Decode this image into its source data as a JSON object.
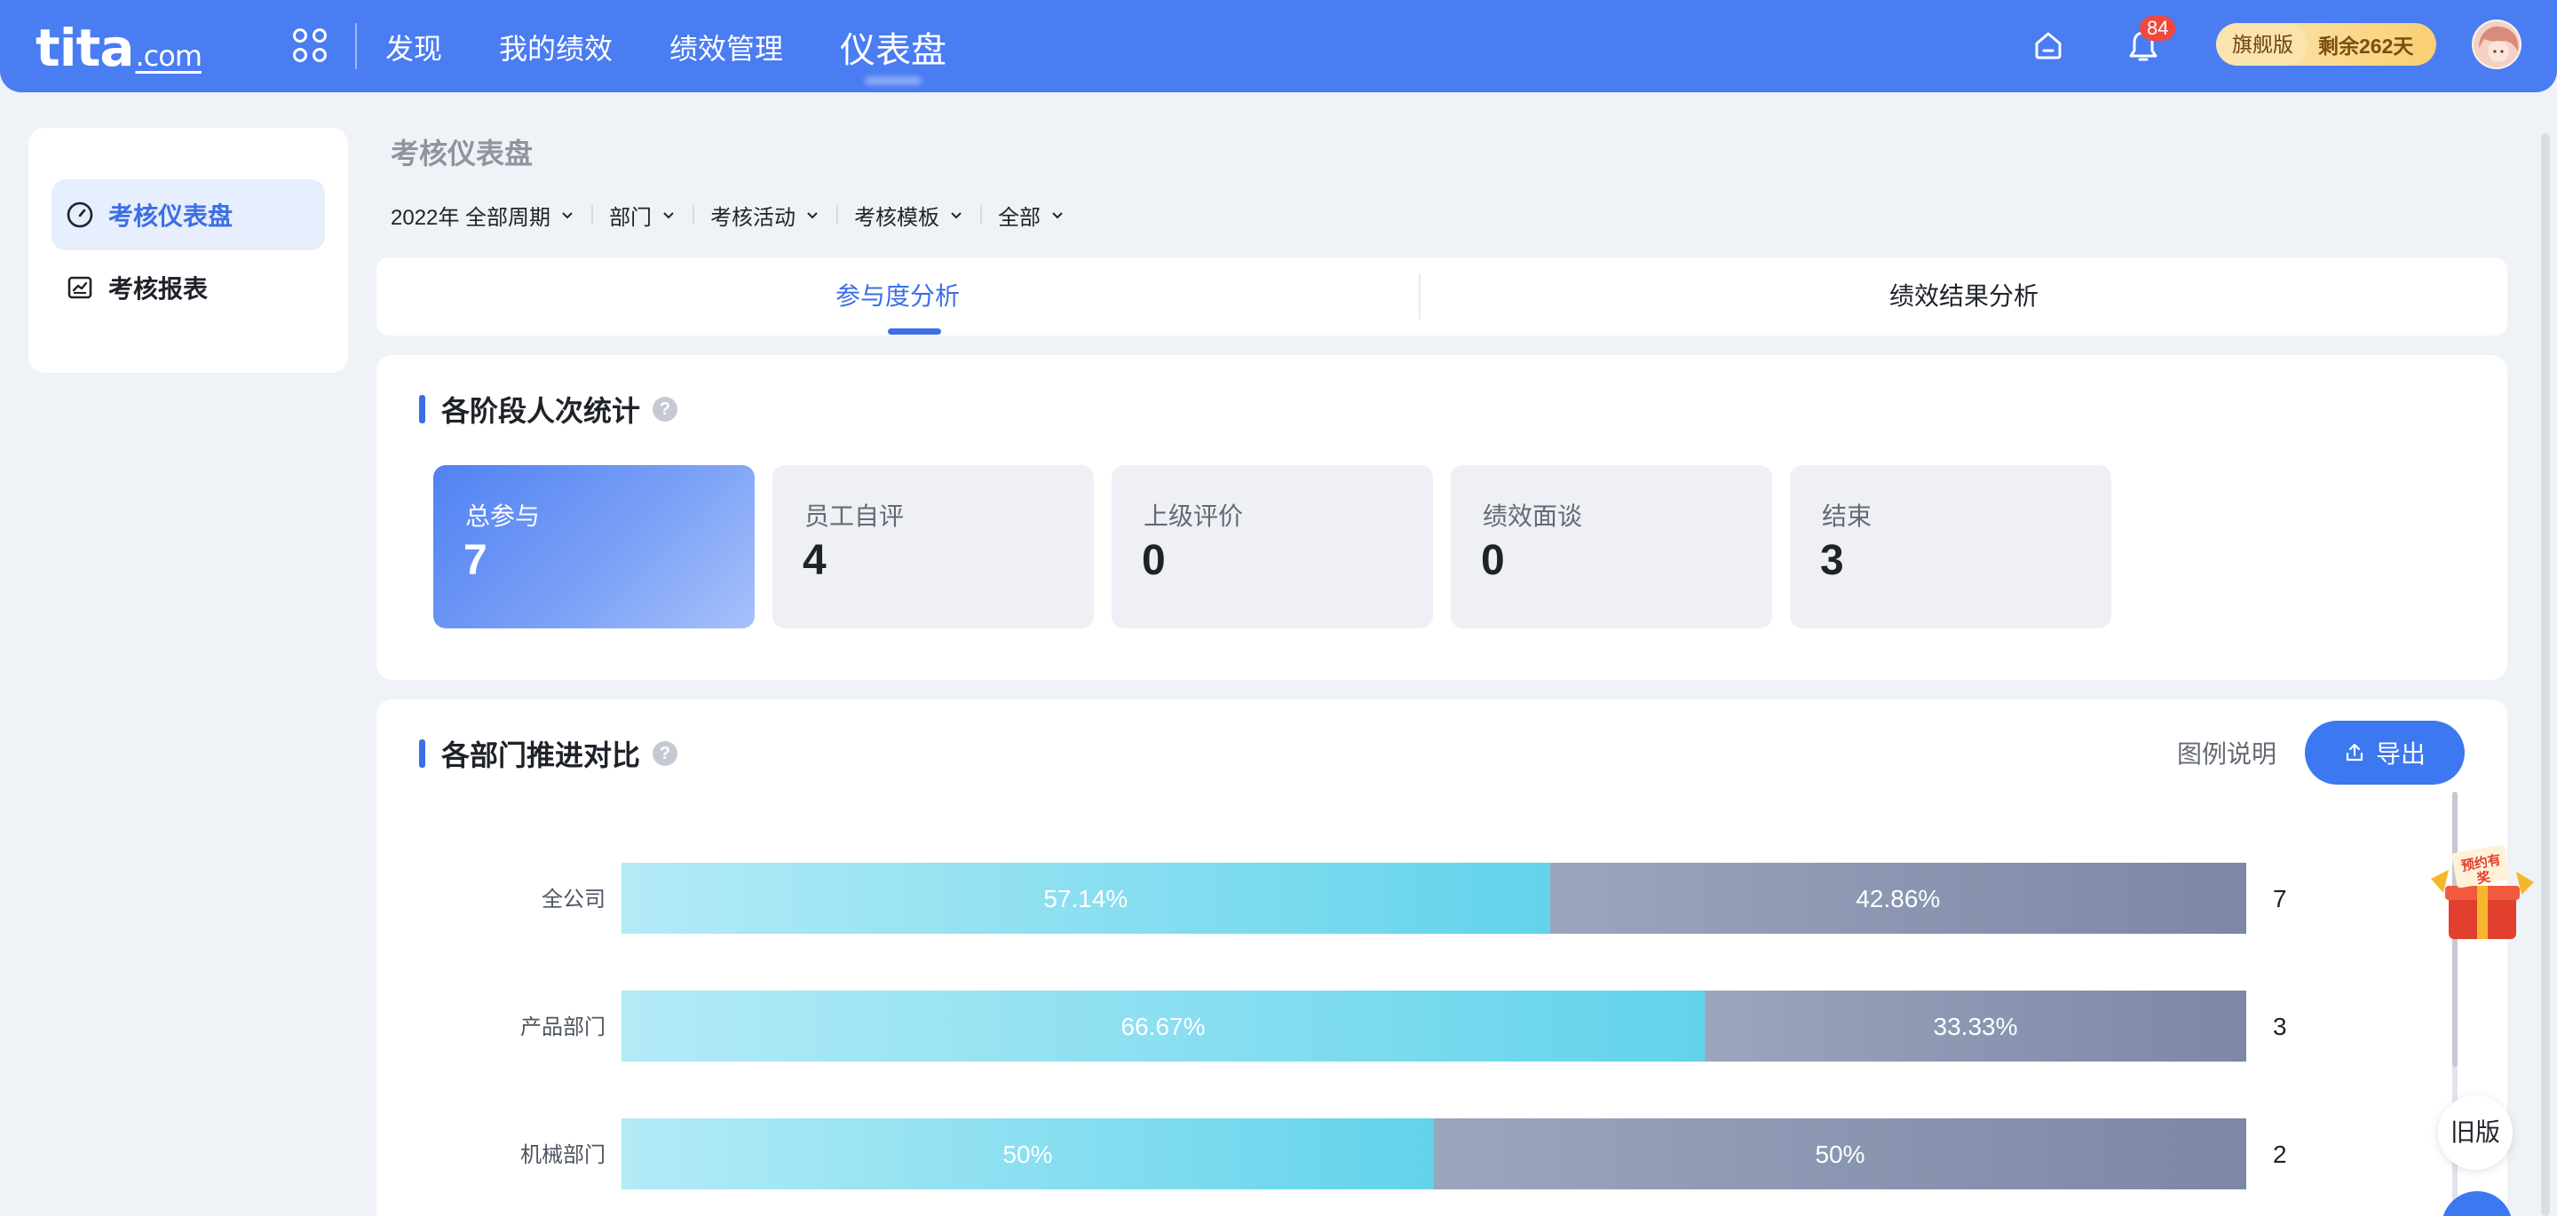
{
  "app": {
    "logo": "tita",
    "logo_suffix": ".com",
    "nav": [
      "发现",
      "我的绩效",
      "绩效管理",
      "仪表盘"
    ],
    "notification_count": "84",
    "plan_name": "旗舰版",
    "plan_remaining": "剩余262天"
  },
  "sidebar": {
    "items": [
      {
        "label": "考核仪表盘",
        "icon": "gauge-icon",
        "active": true
      },
      {
        "label": "考核报表",
        "icon": "chart-report-icon",
        "active": false
      }
    ]
  },
  "main": {
    "title": "考核仪表盘",
    "filters": [
      "2022年 全部周期",
      "部门",
      "考核活动",
      "考核模板",
      "全部"
    ],
    "tabs": [
      "参与度分析",
      "绩效结果分析"
    ],
    "active_tab": 0
  },
  "stage_stats": {
    "title": "各阶段人次统计",
    "items": [
      {
        "label": "总参与",
        "value": "7"
      },
      {
        "label": "员工自评",
        "value": "4"
      },
      {
        "label": "上级评价",
        "value": "0"
      },
      {
        "label": "绩效面谈",
        "value": "0"
      },
      {
        "label": "结束",
        "value": "3"
      }
    ]
  },
  "dept_compare": {
    "title": "各部门推进对比",
    "legend_label": "图例说明",
    "export_label": "导出"
  },
  "floating": {
    "old_version": "旧版",
    "promo_text": "预约有奖"
  },
  "colors": {
    "brand": "#4a7cf2",
    "accent": "#3c6fe6",
    "bar_progress": "#6dd6ec",
    "bar_remaining": "#8a96b0"
  },
  "chart_data": {
    "type": "bar",
    "orientation": "horizontal-stacked",
    "categories": [
      "全公司",
      "产品部门",
      "机械部门"
    ],
    "series": [
      {
        "values": [
          57.14,
          66.67,
          50
        ]
      },
      {
        "values": [
          42.86,
          33.33,
          50
        ]
      }
    ],
    "data_labels": [
      [
        "57.14%",
        "66.67%",
        "50%"
      ],
      [
        "42.86%",
        "33.33%",
        "50%"
      ]
    ],
    "totals": [
      "7",
      "3",
      "2"
    ],
    "xlim": [
      0,
      100
    ]
  }
}
